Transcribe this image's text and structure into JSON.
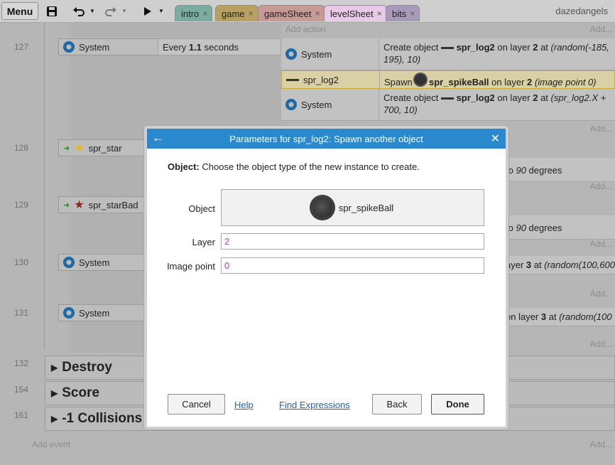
{
  "topbar": {
    "menu": "Menu",
    "tabs": [
      {
        "label": "intro",
        "color": "#7aaca1"
      },
      {
        "label": "game",
        "color": "#b8a060"
      },
      {
        "label": "gameSheet",
        "color": "#c89a96"
      },
      {
        "label": "levelSheet",
        "color": "#e8c9e8"
      },
      {
        "label": "bits",
        "color": "#a89aba"
      }
    ],
    "tab_close": "×",
    "user": "dazedangels"
  },
  "sheet": {
    "add_action": "Add action",
    "add_short": "Add...",
    "add_event": "Add event",
    "rows": [
      {
        "num": "127",
        "cond_obj": "System",
        "cond_text_pre": "Every ",
        "cond_bold": "1.1",
        "cond_text_post": " seconds"
      },
      {
        "num": "128",
        "cond_obj": "spr_star"
      },
      {
        "num": "129",
        "cond_obj": "spr_starBad"
      },
      {
        "num": "130",
        "cond_obj": "System"
      },
      {
        "num": "131",
        "cond_obj": "System"
      }
    ],
    "actions": [
      {
        "obj": "System",
        "pre": "Create object ",
        "name": "spr_log2",
        "mid": " on layer ",
        "layer": "2",
        "post": " at ",
        "args": "(random(-185, 195), 10)"
      },
      {
        "obj": "spr_log2",
        "pre": "Spawn ",
        "name": "spr_spikeBall",
        "mid": " on layer ",
        "layer": "2",
        "post": " ",
        "args": "(image point 0)"
      },
      {
        "obj": "System",
        "pre": "Create object ",
        "name": "spr_log2",
        "mid": " on layer ",
        "layer": "2",
        "post": " at ",
        "args": "(spr_log2.X + 700, 10)"
      }
    ],
    "partial_actions": [
      {
        "pre": "to ",
        "it": "90",
        "post": " degrees"
      },
      {
        "pre": "to ",
        "it": "90",
        "post": " degrees"
      },
      {
        "pre": "ayer ",
        "bold": "3",
        "post": " at ",
        "it": "(random(100,600"
      },
      {
        "pre": "on layer ",
        "bold": "3",
        "post": " at ",
        "it": "(random(100"
      }
    ],
    "groups": [
      {
        "num": "132",
        "label": "Destroy"
      },
      {
        "num": "154",
        "label": "Score"
      },
      {
        "num": "161",
        "label": "-1 Collisions"
      }
    ]
  },
  "dialog": {
    "title": "Parameters for spr_log2: Spawn another object",
    "desc_bold": "Object:",
    "desc": " Choose the object type of the new instance to create.",
    "params": {
      "object_label": "Object",
      "object_value": "spr_spikeBall",
      "layer_label": "Layer",
      "layer_value": "2",
      "image_point_label": "Image point",
      "image_point_value": "0"
    },
    "buttons": {
      "cancel": "Cancel",
      "help": "Help",
      "find": "Find Expressions",
      "back": "Back",
      "done": "Done"
    }
  }
}
